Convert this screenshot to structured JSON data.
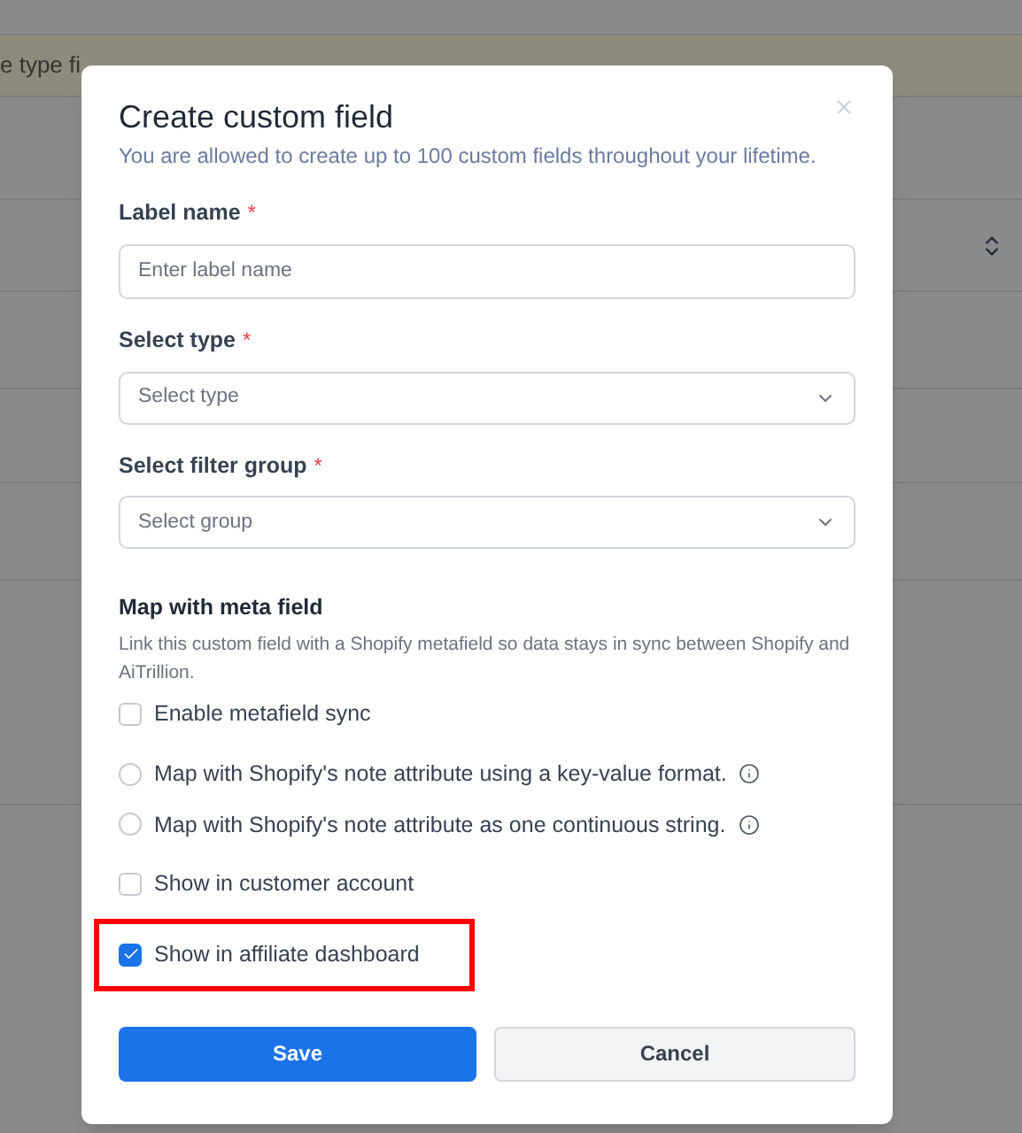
{
  "background": {
    "banner_text": "e type fi"
  },
  "dialog": {
    "title": "Create custom field",
    "subtitle": "You are allowed to create up to 100 custom fields throughout your lifetime.",
    "fields": [
      {
        "kind": "text",
        "label": "Label name",
        "required_mark": "*",
        "placeholder": "Enter label name"
      },
      {
        "kind": "select",
        "label": "Select type",
        "required_mark": "*",
        "placeholder": "Select type"
      },
      {
        "kind": "select",
        "label": "Select filter group",
        "required_mark": "*",
        "placeholder": "Select group"
      }
    ],
    "meta": {
      "heading": "Map with meta field",
      "description": "Link this custom field with a Shopify metafield so data stays in sync between Shopify and AiTrillion.",
      "options": [
        {
          "kind": "checkbox",
          "label": "Enable metafield sync",
          "checked": false,
          "info": false
        },
        {
          "kind": "radio",
          "label": "Map with Shopify's note attribute using a key-value format.",
          "selected": false,
          "info": true
        },
        {
          "kind": "radio",
          "label": "Map with Shopify's note attribute as one continuous string.",
          "selected": false,
          "info": true
        },
        {
          "kind": "checkbox",
          "label": "Show in customer account",
          "checked": false,
          "info": false
        },
        {
          "kind": "checkbox",
          "label": "Show in affiliate dashboard",
          "checked": true,
          "info": false,
          "highlighted": true
        }
      ]
    },
    "buttons": [
      {
        "kind": "primary",
        "label": "Save"
      },
      {
        "kind": "secondary",
        "label": "Cancel"
      }
    ]
  }
}
